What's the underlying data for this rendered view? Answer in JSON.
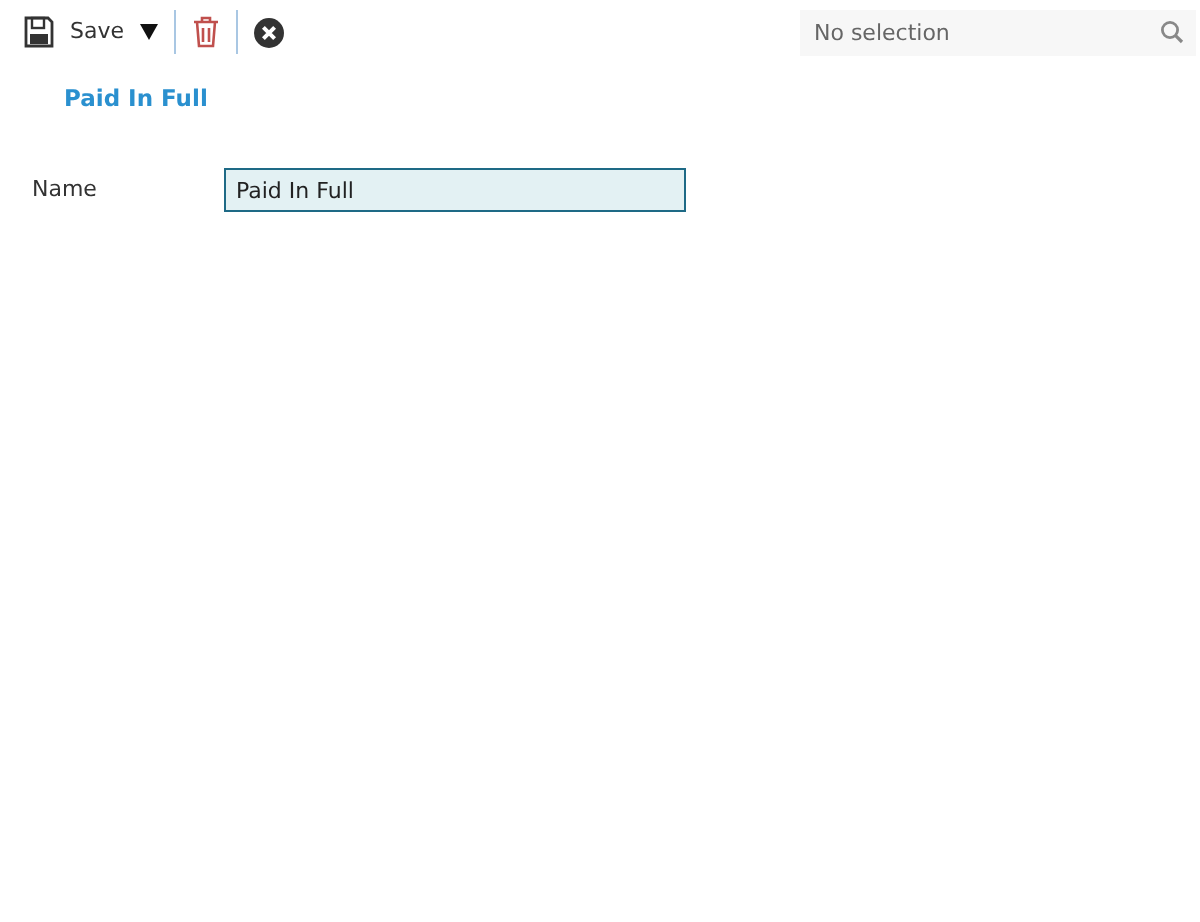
{
  "toolbar": {
    "save_label": "Save"
  },
  "search": {
    "placeholder": "No selection"
  },
  "title": "Paid In Full",
  "fields": [
    {
      "label": "Name",
      "value": "Paid In Full"
    }
  ]
}
